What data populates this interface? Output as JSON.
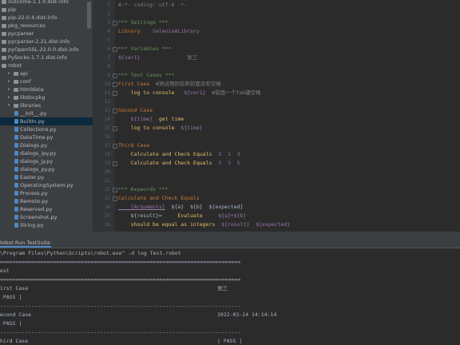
{
  "project_tree": {
    "items": [
      {
        "label": "outcome-1.1.0.dist-info",
        "kind": "folder",
        "indent": 0
      },
      {
        "label": "pip",
        "kind": "folder",
        "indent": 0
      },
      {
        "label": "pip-22.0.4.dist-info",
        "kind": "folder",
        "indent": 0
      },
      {
        "label": "pkg_resources",
        "kind": "folder",
        "indent": 0
      },
      {
        "label": "pycparser",
        "kind": "folder",
        "indent": 0
      },
      {
        "label": "pycparser-2.21.dist-info",
        "kind": "folder",
        "indent": 0
      },
      {
        "label": "pyOpenSSL-22.0.0.dist-info",
        "kind": "folder",
        "indent": 0
      },
      {
        "label": "PySocks-1.7.1.dist-info",
        "kind": "folder",
        "indent": 0
      },
      {
        "label": "robot",
        "kind": "folder",
        "indent": 0,
        "expanded": true
      },
      {
        "label": "api",
        "kind": "folder",
        "indent": 1
      },
      {
        "label": "conf",
        "kind": "folder",
        "indent": 1
      },
      {
        "label": "htmldata",
        "kind": "folder",
        "indent": 1
      },
      {
        "label": "libdocpkg",
        "kind": "folder",
        "indent": 1
      },
      {
        "label": "libraries",
        "kind": "folder",
        "indent": 1,
        "expanded": true
      },
      {
        "label": "__init__.py",
        "kind": "py",
        "indent": 2
      },
      {
        "label": "BuiltIn.py",
        "kind": "py",
        "indent": 2,
        "selected": true
      },
      {
        "label": "Collections.py",
        "kind": "py",
        "indent": 2
      },
      {
        "label": "DateTime.py",
        "kind": "py",
        "indent": 2
      },
      {
        "label": "Dialogs.py",
        "kind": "py",
        "indent": 2
      },
      {
        "label": "dialogs_ipy.py",
        "kind": "py",
        "indent": 2
      },
      {
        "label": "dialogs_jy.py",
        "kind": "py",
        "indent": 2
      },
      {
        "label": "dialogs_py.py",
        "kind": "py",
        "indent": 2
      },
      {
        "label": "Easter.py",
        "kind": "py",
        "indent": 2
      },
      {
        "label": "OperatingSystem.py",
        "kind": "py",
        "indent": 2
      },
      {
        "label": "Process.py",
        "kind": "py",
        "indent": 2
      },
      {
        "label": "Remote.py",
        "kind": "py",
        "indent": 2
      },
      {
        "label": "Reserved.py",
        "kind": "py",
        "indent": 2
      },
      {
        "label": "Screenshot.py",
        "kind": "py",
        "indent": 2
      },
      {
        "label": "String.py",
        "kind": "py",
        "indent": 2
      }
    ]
  },
  "editor": {
    "line_numbers": [
      "1",
      "2",
      "3",
      "4",
      "5",
      "6",
      "7",
      "8",
      "9",
      "10",
      "11",
      "12",
      "13",
      "14",
      "15",
      "16",
      "17",
      "18",
      "19",
      "20",
      "21",
      "22",
      "23",
      "24",
      "25",
      "26"
    ],
    "lines": [
      [
        {
          "t": "#-*- coding: utf-8 -*-",
          "c": "c-com"
        }
      ],
      [],
      [
        {
          "t": "*** Settings ***",
          "c": "c-hdr"
        }
      ],
      [
        {
          "t": "Library",
          "c": "c-kw"
        },
        {
          "t": "    SeleniumLibrary",
          "c": "c-lib"
        }
      ],
      [],
      [
        {
          "t": "*** Variables ***",
          "c": "c-hdr"
        }
      ],
      [
        {
          "t": "${var1}",
          "c": "c-var"
        },
        {
          "t": "               张三",
          "c": "c-com"
        }
      ],
      [],
      [
        {
          "t": "*** Test Cases ***",
          "c": "c-hdr"
        }
      ],
      [
        {
          "t": "First Case",
          "c": "c-tname"
        },
        {
          "t": "  #测试用例名称前面没有空格",
          "c": "c-com"
        }
      ],
      [
        {
          "t": "    log to console",
          "c": "c-key"
        },
        {
          "t": "   ${var1}",
          "c": "c-var"
        },
        {
          "t": "  #前面一个Tab键空格",
          "c": "c-com"
        }
      ],
      [],
      [
        {
          "t": "Second Case",
          "c": "c-tname"
        }
      ],
      [
        {
          "t": "    ${time}",
          "c": "c-var"
        },
        {
          "t": "  get time",
          "c": "c-key"
        }
      ],
      [
        {
          "t": "    log to console",
          "c": "c-key"
        },
        {
          "t": "  ${time}",
          "c": "c-var"
        }
      ],
      [],
      [
        {
          "t": "Third Case",
          "c": "c-tname"
        }
      ],
      [
        {
          "t": "    Calculate and Check Equals",
          "c": "c-key"
        },
        {
          "t": "  2  1  3",
          "c": "c-lib"
        }
      ],
      [
        {
          "t": "    Calculate and Check Equals",
          "c": "c-key"
        },
        {
          "t": "  2  3  5",
          "c": "c-lib"
        }
      ],
      [],
      [],
      [
        {
          "t": "*** Keywords ***",
          "c": "c-hdr"
        }
      ],
      [
        {
          "t": "Calculate and Check Equals",
          "c": "c-tname"
        }
      ],
      [
        {
          "t": "    [Arguments]",
          "c": "c-arg"
        },
        {
          "t": "  ${a}  ${b}  ${expected}",
          "c": "c-txt"
        }
      ],
      [
        {
          "t": "    ${result}=",
          "c": "c-txt"
        },
        {
          "t": "     Evaluate",
          "c": "c-key"
        },
        {
          "t": "     ${a}+${b}",
          "c": "c-lib"
        }
      ],
      [
        {
          "t": "    should be equal as integers",
          "c": "c-key"
        },
        {
          "t": "  ${result}",
          "c": "c-lib"
        },
        {
          "t": "  ${expected}",
          "c": "c-lib"
        }
      ]
    ]
  },
  "run_panel": {
    "tab_label": "Robot Run TestSuite",
    "lines": [
      {
        "left": ":\\Program Files\\Python\\Scripts\\robot.exe\" -d log Test.robot",
        "right": ""
      },
      {
        "left": "==============================================================================",
        "right": ""
      },
      {
        "left": "Test",
        "right": ""
      },
      {
        "left": "==============================================================================",
        "right": ""
      },
      {
        "left": "First Case",
        "right": "张三"
      },
      {
        "left": "| PASS |",
        "right": ""
      },
      {
        "left": "------------------------------------------------------------------------------",
        "right": ""
      },
      {
        "left": "Second Case",
        "right": "2022-03-14 14:14:14"
      },
      {
        "left": "| PASS |",
        "right": ""
      },
      {
        "left": "------------------------------------------------------------------------------",
        "right": ""
      },
      {
        "left": "Third Case",
        "right": "| PASS |"
      }
    ]
  }
}
